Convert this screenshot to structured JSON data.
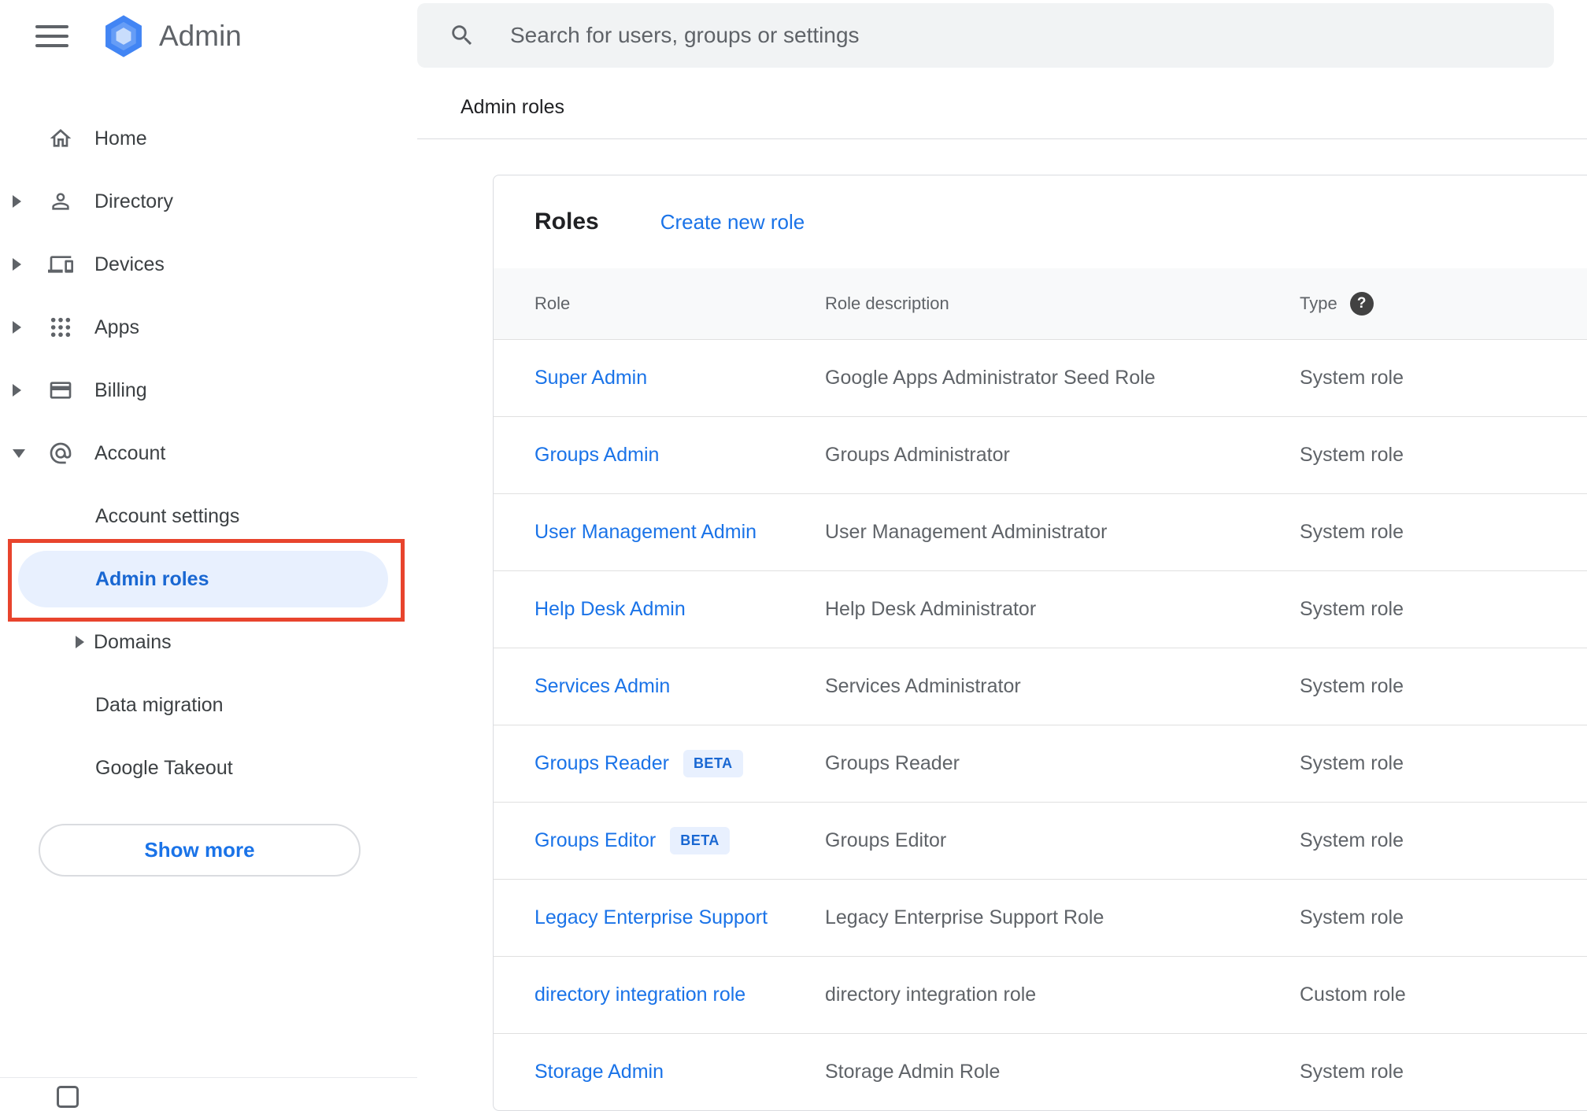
{
  "brand": {
    "name": "Admin"
  },
  "search": {
    "placeholder": "Search for users, groups or settings"
  },
  "breadcrumb": {
    "label": "Admin roles"
  },
  "sidebar": {
    "items": [
      {
        "label": "Home"
      },
      {
        "label": "Directory"
      },
      {
        "label": "Devices"
      },
      {
        "label": "Apps"
      },
      {
        "label": "Billing"
      },
      {
        "label": "Account"
      }
    ],
    "account_children": [
      {
        "label": "Account settings"
      },
      {
        "label": "Admin roles"
      },
      {
        "label": "Domains"
      },
      {
        "label": "Data migration"
      },
      {
        "label": "Google Takeout"
      }
    ],
    "show_more_label": "Show more"
  },
  "roles": {
    "title": "Roles",
    "create_link": "Create new role",
    "beta_label": "BETA",
    "help_symbol": "?",
    "columns": {
      "role": "Role",
      "description": "Role description",
      "type": "Type"
    },
    "rows": [
      {
        "role": "Super Admin",
        "description": "Google Apps Administrator Seed Role",
        "type": "System role"
      },
      {
        "role": "Groups Admin",
        "description": "Groups Administrator",
        "type": "System role"
      },
      {
        "role": "User Management Admin",
        "description": "User Management Administrator",
        "type": "System role"
      },
      {
        "role": "Help Desk Admin",
        "description": "Help Desk Administrator",
        "type": "System role"
      },
      {
        "role": "Services Admin",
        "description": "Services Administrator",
        "type": "System role"
      },
      {
        "role": "Groups Reader",
        "description": "Groups Reader",
        "type": "System role"
      },
      {
        "role": "Groups Editor",
        "description": "Groups Editor",
        "type": "System role"
      },
      {
        "role": "Legacy Enterprise Support",
        "description": "Legacy Enterprise Support Role",
        "type": "System role"
      },
      {
        "role": "directory integration role",
        "description": "directory integration role",
        "type": "Custom role"
      },
      {
        "role": "Storage Admin",
        "description": "Storage Admin Role",
        "type": "System role"
      }
    ]
  },
  "colors": {
    "link_blue": "#1a73e8",
    "active_item_bg": "#e8f0fe",
    "active_item_text": "#1967d2",
    "beta_badge_bg": "#e8f0fe",
    "beta_badge_text": "#1967d2",
    "annotation_red": "#e8442d",
    "searchbar_bg": "#f1f3f4",
    "table_header_bg": "#f8f9fa"
  }
}
